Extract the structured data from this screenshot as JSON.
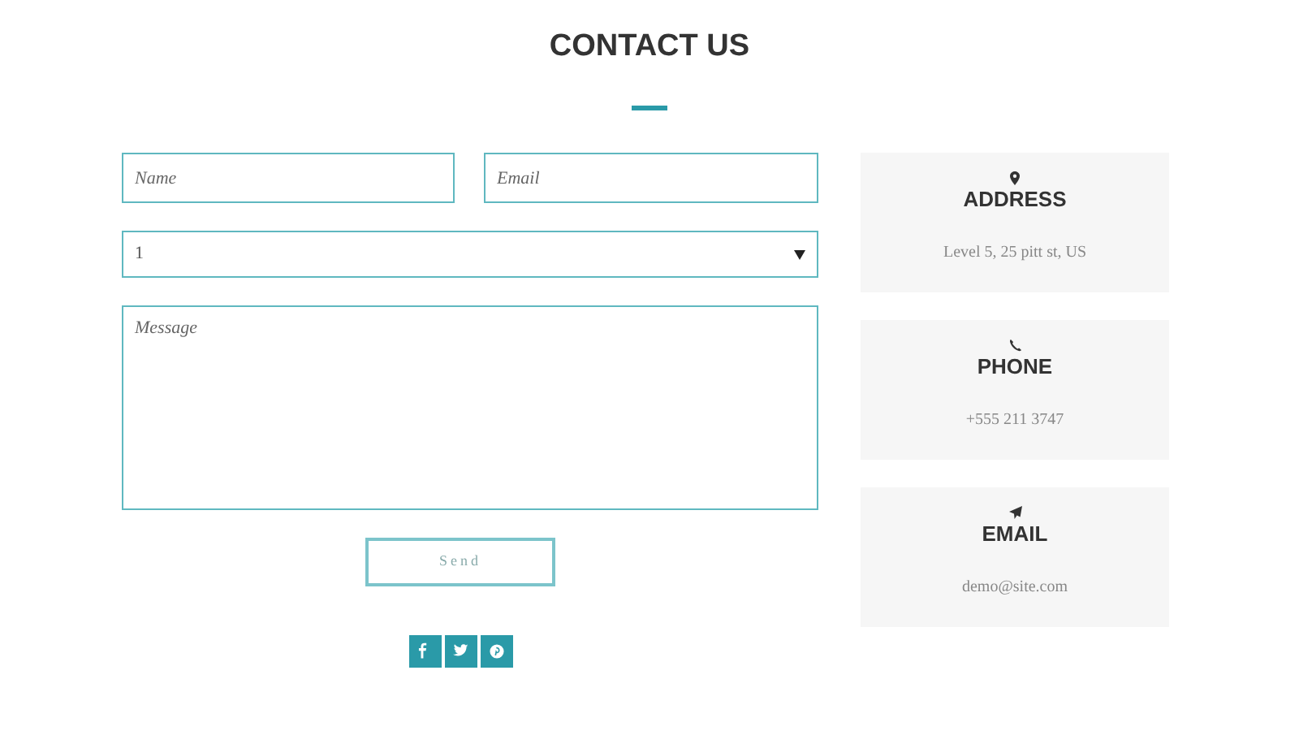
{
  "title": "CONTACT US",
  "form": {
    "name": {
      "placeholder": "Name"
    },
    "email": {
      "placeholder": "Email"
    },
    "select": {
      "value": "1"
    },
    "message": {
      "placeholder": "Message"
    },
    "submit": "Send"
  },
  "social": [
    {
      "kind": "facebook"
    },
    {
      "kind": "twitter"
    },
    {
      "kind": "pinterest"
    }
  ],
  "cards": [
    {
      "kind": "address",
      "heading": "ADDRESS",
      "text": "Level 5, 25 pitt st, US"
    },
    {
      "kind": "phone",
      "heading": "PHONE",
      "text": "+555 211 3747"
    },
    {
      "kind": "email",
      "heading": "EMAIL",
      "text": "demo@site.com"
    }
  ]
}
